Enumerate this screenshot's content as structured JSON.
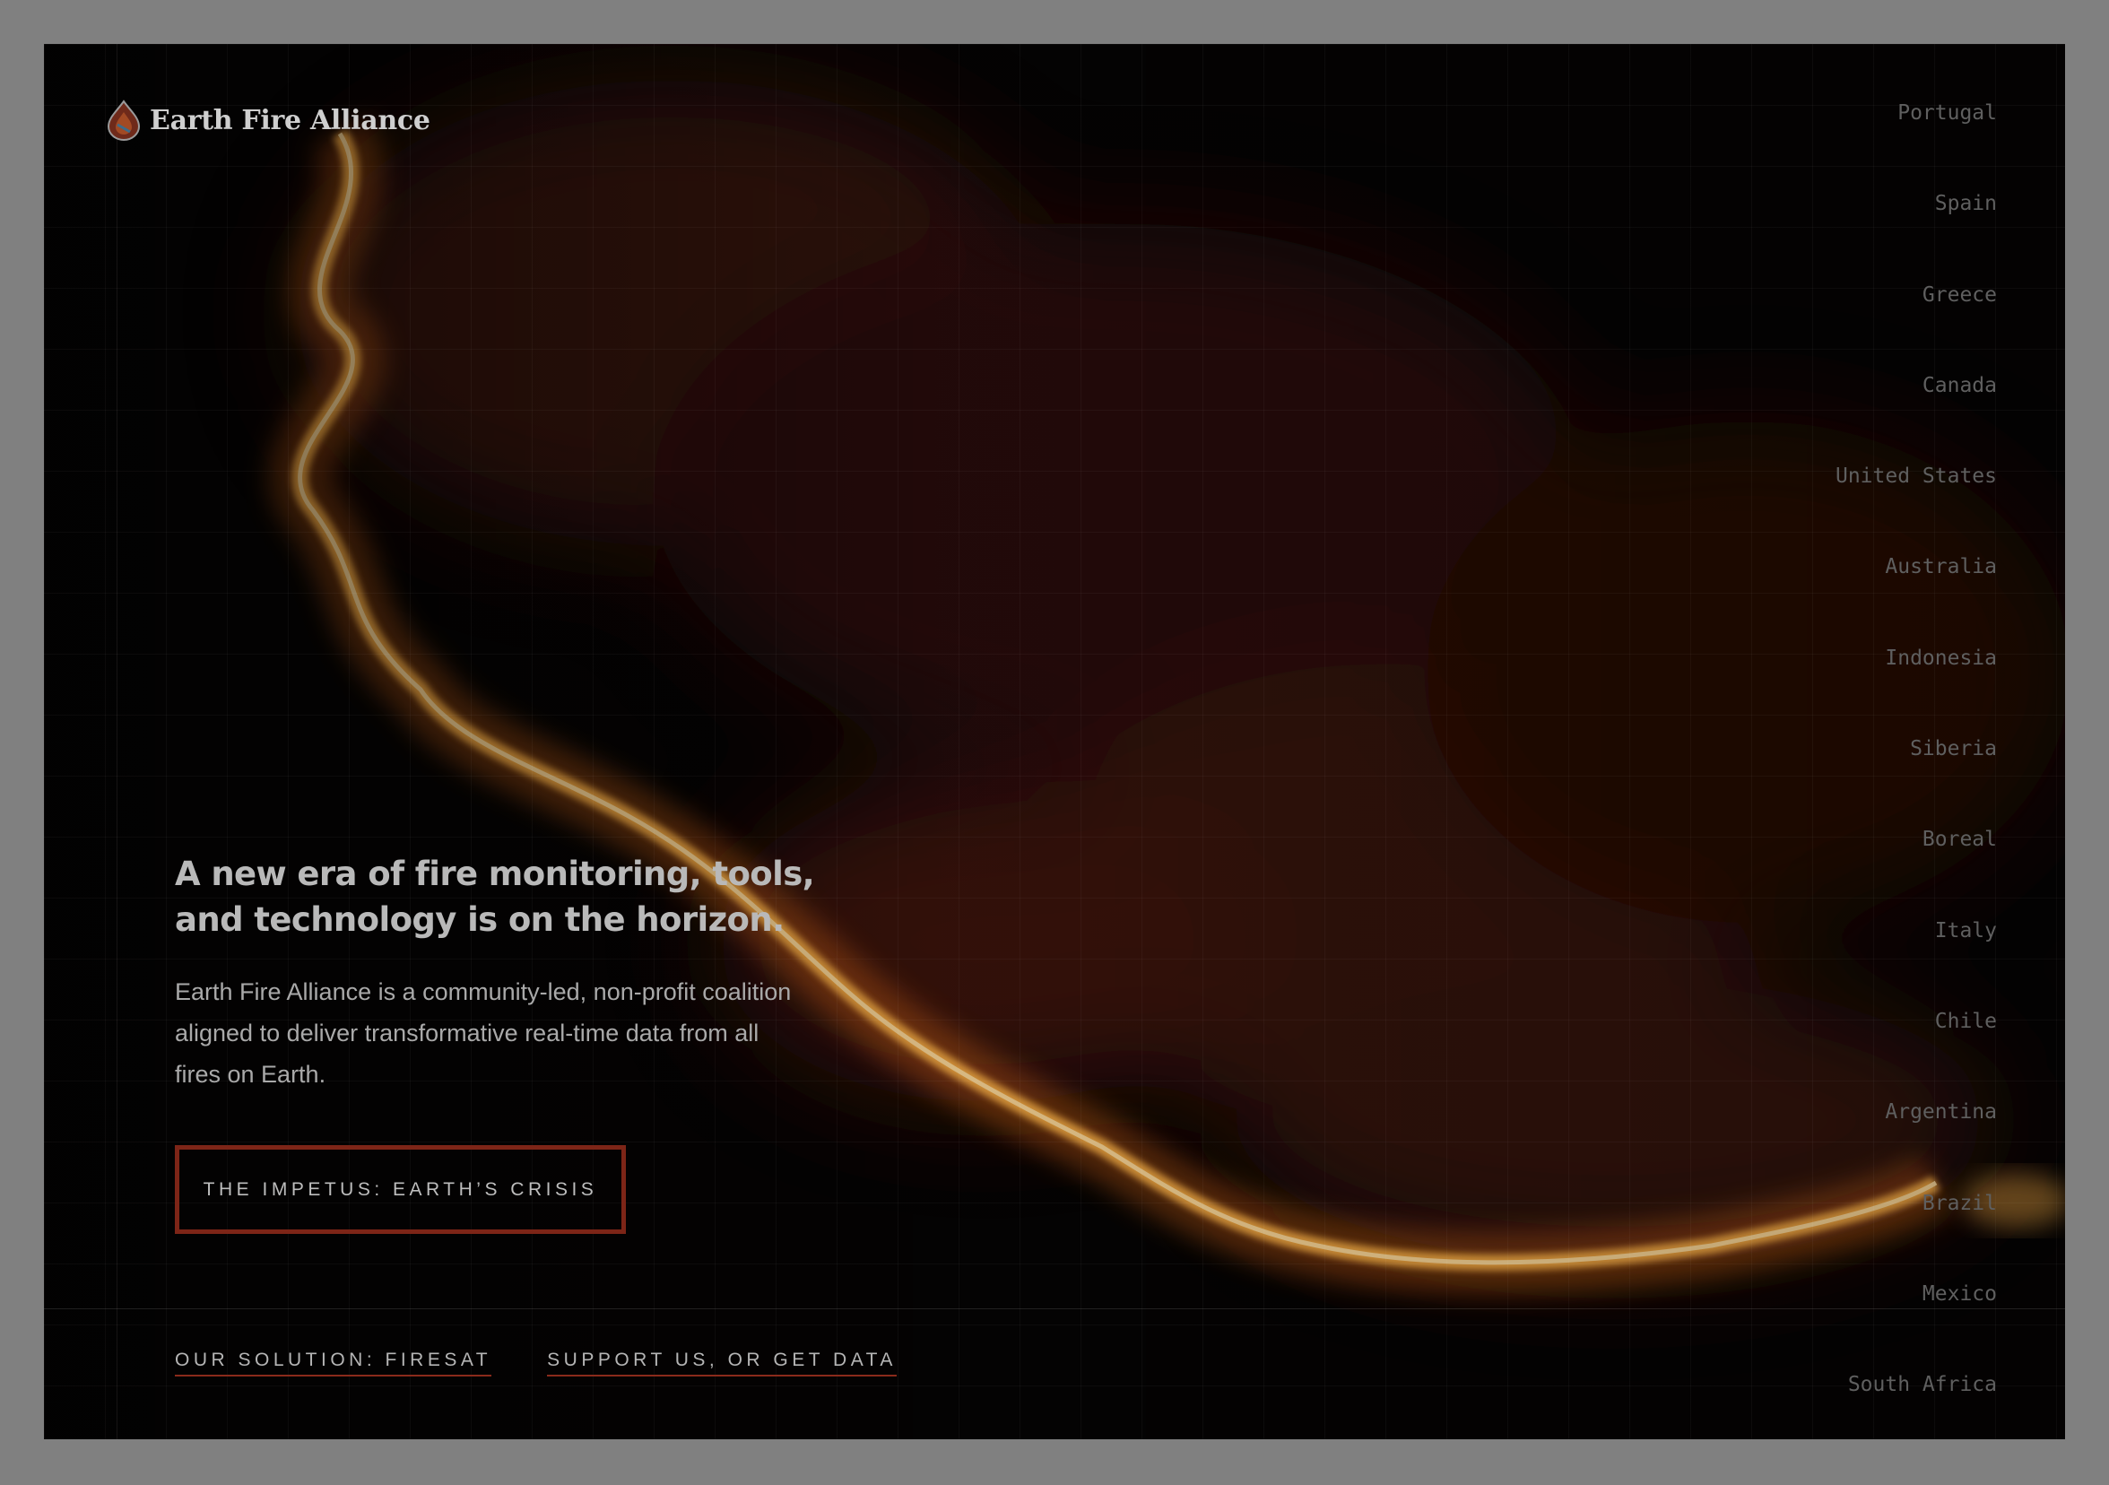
{
  "brand": {
    "name": "Earth Fire Alliance",
    "icon": "flame-drop-icon"
  },
  "hero": {
    "headline": "A new era of fire monitoring, tools, and technology is on the horizon.",
    "intro": "Earth Fire Alliance is a community-led, non-profit coalition aligned to deliver transformative real-time data from all fires on Earth.",
    "cta_label": "THE IMPETUS: EARTH’S CRISIS"
  },
  "bottom_nav": [
    {
      "label": "OUR SOLUTION: FIRESAT"
    },
    {
      "label": "SUPPORT US, OR GET DATA"
    }
  ],
  "regions": [
    "Portugal",
    "Spain",
    "Greece",
    "Canada",
    "United States",
    "Australia",
    "Indonesia",
    "Siberia",
    "Boreal",
    "Italy",
    "Chile",
    "Argentina",
    "Brazil",
    "Mexico",
    "South Africa"
  ],
  "colors": {
    "accent": "#7d2517",
    "fire": "#ffb347",
    "background": "#050303"
  }
}
